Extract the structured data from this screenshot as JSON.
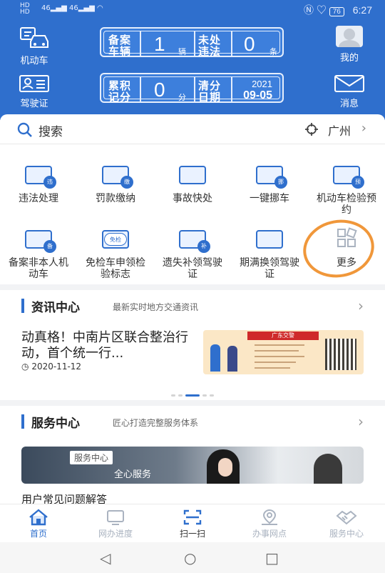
{
  "status_bar": {
    "left": "HD 46 46",
    "battery": "76",
    "time": "6:27"
  },
  "header": {
    "vehicle_label": "机动车",
    "license_label": "驾驶证",
    "mine_label": "我的",
    "message_label": "消息",
    "card1": {
      "label_a": "备案车辆",
      "value_a": "1",
      "unit_a": "辆",
      "label_b": "未处违法",
      "value_b": "0",
      "unit_b": "条"
    },
    "card2": {
      "label_a": "累积记分",
      "value_a": "0",
      "unit_a": "分",
      "label_b": "清分日期",
      "year": "2021",
      "date": "09-05"
    }
  },
  "search": {
    "placeholder": "搜索",
    "city": "广州"
  },
  "services": [
    {
      "label": "违法处理",
      "icon": "car-violation-icon",
      "badge": "违"
    },
    {
      "label": "罚款缴纳",
      "icon": "fine-payment-icon",
      "badge": "缴"
    },
    {
      "label": "事故快处",
      "icon": "accident-icon",
      "badge": ""
    },
    {
      "label": "一键挪车",
      "icon": "move-car-icon",
      "badge": "挪"
    },
    {
      "label": "机动车检验预约",
      "icon": "inspection-booking-icon",
      "badge": "预"
    },
    {
      "label": "备案非本人机动车",
      "icon": "register-vehicle-icon",
      "badge": "备"
    },
    {
      "label": "免检车申领检验标志",
      "icon": "exempt-sticker-icon",
      "badge": "免检"
    },
    {
      "label": "遗失补领驾驶证",
      "icon": "reissue-license-icon",
      "badge": "补"
    },
    {
      "label": "期满换领驾驶证",
      "icon": "renew-license-icon",
      "badge": ""
    },
    {
      "label": "更多",
      "icon": "more-grid-icon",
      "badge": ""
    }
  ],
  "news": {
    "title": "资讯中心",
    "subtitle": "最新实时地方交通资讯",
    "item_title": "动真格！中南片区联合整治行动，首个统一行...",
    "item_date": "2020-11-12",
    "image_brand": "广东交警"
  },
  "service_center": {
    "title": "服务中心",
    "subtitle": "匠心打造完整服务体系",
    "banner_tag": "服务中心",
    "banner_text": "全心服务",
    "faq": "用户常见问题解答"
  },
  "tabs": [
    {
      "label": "首页",
      "icon": "home-icon"
    },
    {
      "label": "网办进度",
      "icon": "monitor-icon"
    },
    {
      "label": "扫一扫",
      "icon": "scan-icon"
    },
    {
      "label": "办事网点",
      "icon": "location-icon"
    },
    {
      "label": "服务中心",
      "icon": "handshake-icon"
    }
  ],
  "colors": {
    "primary": "#2f6fcd",
    "highlight_circle": "#f0973a"
  }
}
